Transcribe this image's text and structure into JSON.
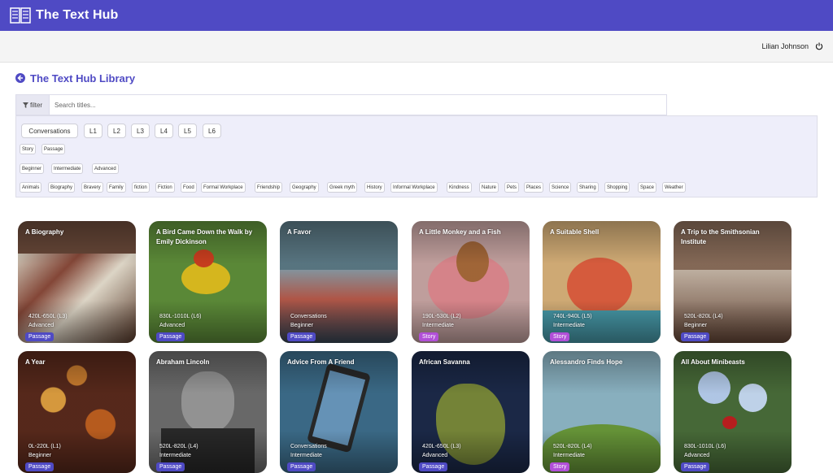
{
  "app": {
    "title": "The Text Hub"
  },
  "user": {
    "name": "Lilian Johnson"
  },
  "page": {
    "title": "The Text Hub Library"
  },
  "search": {
    "filter_label": "filter",
    "placeholder": "Search titles..."
  },
  "filters": {
    "levels": [
      "Conversations",
      "L1",
      "L2",
      "L3",
      "L4",
      "L5",
      "L6"
    ],
    "types": [
      "Story",
      "Passage"
    ],
    "difficulty": [
      "Beginner",
      "Intermediate",
      "Advanced"
    ],
    "topics": [
      "Animals",
      "Biography",
      "Bravery",
      "Family",
      "fiction",
      "Fiction",
      "Food",
      "Formal Workplace",
      "Friendship",
      "Geography",
      "Greek myth",
      "History",
      "Informal Workplace",
      "Kindness",
      "Nature",
      "Pets",
      "Places",
      "Science",
      "Sharing",
      "Shopping",
      "Space",
      "Weather"
    ]
  },
  "cards": [
    {
      "title": "A Biography",
      "level": "420L-650L (L3)",
      "difficulty": "Advanced",
      "type": "Passage",
      "bg": "#6b4a3a"
    },
    {
      "title": "A Bird Came Down the Walk by Emily Dickinson",
      "level": "830L-1010L (L6)",
      "difficulty": "Advanced",
      "type": "Passage",
      "bg": "#5f8f3a"
    },
    {
      "title": "A Favor",
      "level": "Conversations",
      "difficulty": "Beginner",
      "type": "Passage",
      "bg": "#5c7a86"
    },
    {
      "title": "A Little Monkey and a Fish",
      "level": "190L-530L (L2)",
      "difficulty": "Intermediate",
      "type": "Story",
      "bg": "#c9a6a4"
    },
    {
      "title": "A Suitable Shell",
      "level": "740L-940L (L5)",
      "difficulty": "Intermediate",
      "type": "Story",
      "bg": "#d9b27a"
    },
    {
      "title": "A Trip to the Smithsonian Institute",
      "level": "520L-820L (L4)",
      "difficulty": "Beginner",
      "type": "Passage",
      "bg": "#8a6d5a"
    },
    {
      "title": "A Year",
      "level": "0L-220L (L1)",
      "difficulty": "Beginner",
      "type": "Passage",
      "bg": "#5a2a1c"
    },
    {
      "title": "Abraham Lincoln",
      "level": "520L-820L (L4)",
      "difficulty": "Intermediate",
      "type": "Passage",
      "bg": "#6e6e6e"
    },
    {
      "title": "Advice From A Friend",
      "level": "Conversations",
      "difficulty": "Intermediate",
      "type": "Passage",
      "bg": "#3d6e8c"
    },
    {
      "title": "African Savanna",
      "level": "420L-650L (L3)",
      "difficulty": "Advanced",
      "type": "Passage",
      "bg": "#1c2a4a"
    },
    {
      "title": "Alessandro Finds Hope",
      "level": "520L-820L (L4)",
      "difficulty": "Intermediate",
      "type": "Story",
      "bg": "#8fb8c8"
    },
    {
      "title": "All About Minibeasts",
      "level": "830L-1010L (L6)",
      "difficulty": "Advanced",
      "type": "Passage",
      "bg": "#4a6e3a"
    }
  ],
  "colors": {
    "brand": "#4f4ac4",
    "story_badge": "#b14fd8",
    "passage_badge": "#4f4ac4"
  }
}
